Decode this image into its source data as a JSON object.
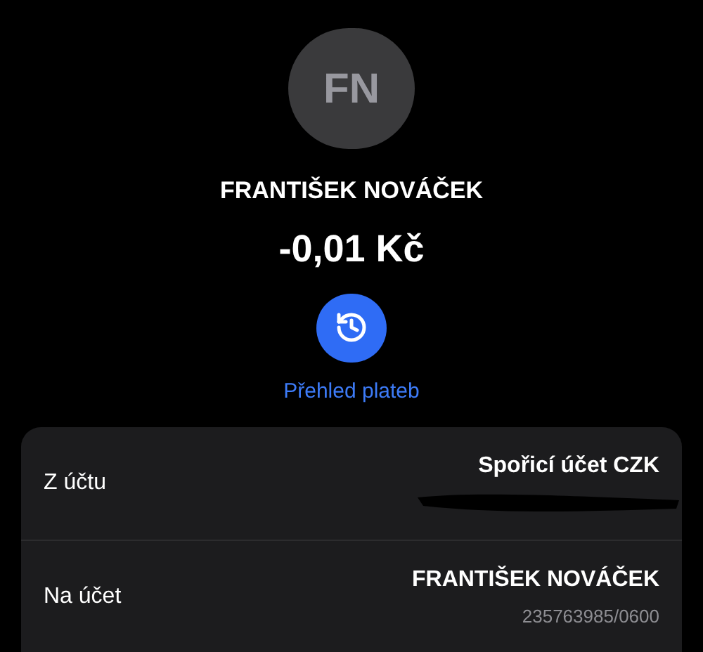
{
  "contact": {
    "initials": "FN",
    "name": "FRANTIŠEK NOVÁČEK"
  },
  "amount": "-0,01 Kč",
  "history_link": "Přehled plateb",
  "details": [
    {
      "label": "Z účtu",
      "value": "Spořicí účet CZK",
      "redacted": true
    },
    {
      "label": "Na účet",
      "value": "FRANTIŠEK NOVÁČEK",
      "sub": "235763985/0600",
      "redacted": false
    }
  ]
}
